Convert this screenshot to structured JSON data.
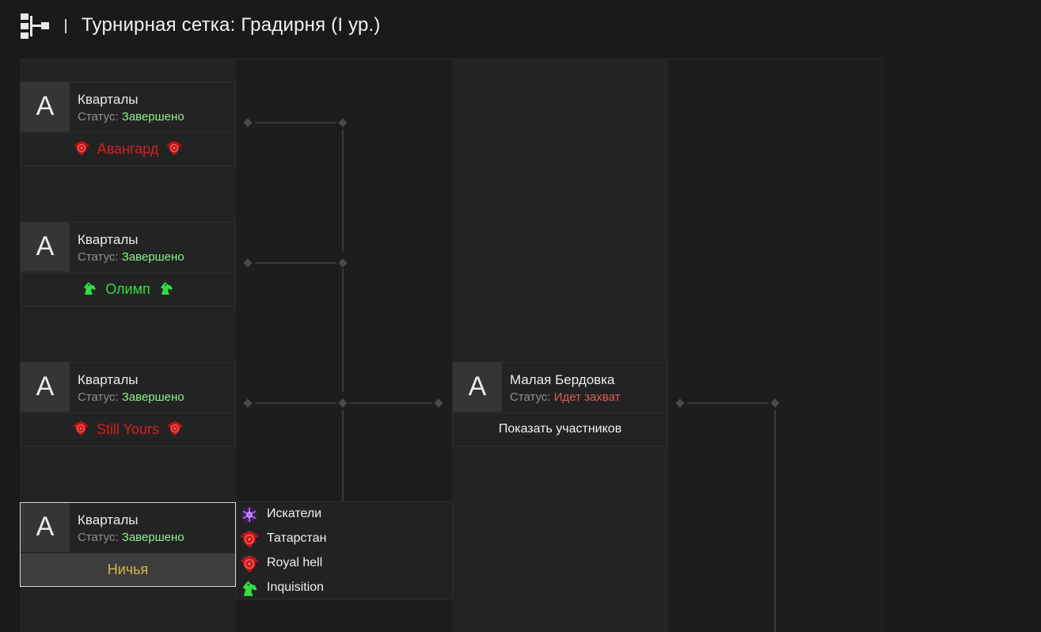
{
  "header": {
    "title": "Турнирная сетка: Градирня (I ур.)",
    "logo_icon": "bracket-icon"
  },
  "colors": {
    "done": "#8cf28c",
    "capture": "#e05a5a",
    "red_team": "#d42020",
    "green_team": "#33dd44",
    "draw": "#d6b84a"
  },
  "round1": [
    {
      "avatar": "А",
      "location": "Кварталы",
      "status_label": "Статус:",
      "status_value": "Завершено",
      "result": "Авангард",
      "result_icon": "red-shield-icon"
    },
    {
      "avatar": "А",
      "location": "Кварталы",
      "status_label": "Статус:",
      "status_value": "Завершено",
      "result": "Олимп",
      "result_icon": "green-horse-icon"
    },
    {
      "avatar": "А",
      "location": "Кварталы",
      "status_label": "Статус:",
      "status_value": "Завершено",
      "result": "Still Yours",
      "result_icon": "red-shield-icon"
    },
    {
      "avatar": "А",
      "location": "Кварталы",
      "status_label": "Статус:",
      "status_value": "Завершено",
      "result": "Ничья",
      "result_icon": ""
    }
  ],
  "round2": {
    "avatar": "А",
    "location": "Малая Бердовка",
    "status_label": "Статус:",
    "status_value": "Идет захват",
    "action": "Показать участников"
  },
  "draw_participants": [
    {
      "name": "Искатели",
      "icon": "purple-snowflake-icon"
    },
    {
      "name": "Татарстан",
      "icon": "red-shield-icon"
    },
    {
      "name": "Royal hell",
      "icon": "red-shield-icon"
    },
    {
      "name": "Inquisition",
      "icon": "green-horse-icon"
    }
  ]
}
